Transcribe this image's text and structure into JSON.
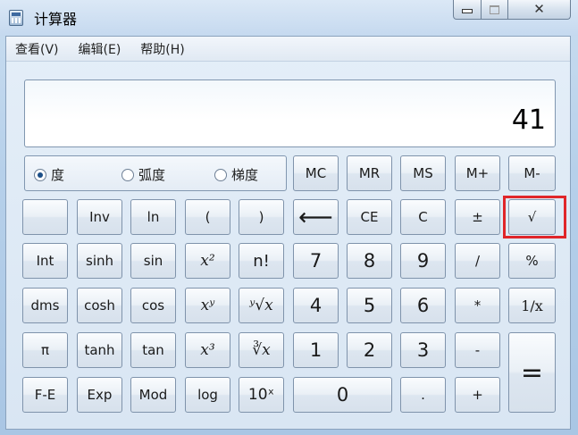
{
  "window": {
    "title": "计算器",
    "min_icon": "minimize-icon",
    "max_icon": "maximize-icon",
    "close_icon": "close-icon"
  },
  "menu": [
    "查看(V)",
    "编辑(E)",
    "帮助(H)"
  ],
  "display": {
    "value": "41"
  },
  "modes": [
    {
      "label": "度",
      "selected": true
    },
    {
      "label": "弧度",
      "selected": false
    },
    {
      "label": "梯度",
      "selected": false
    }
  ],
  "memory_buttons": [
    "MC",
    "MR",
    "MS",
    "M+",
    "M-"
  ],
  "buttons": {
    "blank": "",
    "inv": "Inv",
    "ln": "ln",
    "lparen": "(",
    "rparen": ")",
    "backspace": "⟵",
    "ce": "CE",
    "c": "C",
    "plusminus": "±",
    "sqrt": "√",
    "int": "Int",
    "sinh": "sinh",
    "sin": "sin",
    "x2": "x²",
    "fact": "n!",
    "n7": "7",
    "n8": "8",
    "n9": "9",
    "div": "/",
    "pct": "%",
    "dms": "dms",
    "cosh": "cosh",
    "cos": "cos",
    "xy": "xʸ",
    "yroot": "ʸ√x",
    "n4": "4",
    "n5": "5",
    "n6": "6",
    "mul": "*",
    "recip": "1/x",
    "pi": "π",
    "tanh": "tanh",
    "tan": "tan",
    "x3": "x³",
    "cbrt": "∛x",
    "n1": "1",
    "n2": "2",
    "n3": "3",
    "sub": "-",
    "eq": "=",
    "fe": "F-E",
    "exp": "Exp",
    "mod": "Mod",
    "log": "log",
    "tenx": "10ˣ",
    "n0": "0",
    "dot": ".",
    "add": "+"
  },
  "colors": {
    "highlight": "#e0262a"
  }
}
